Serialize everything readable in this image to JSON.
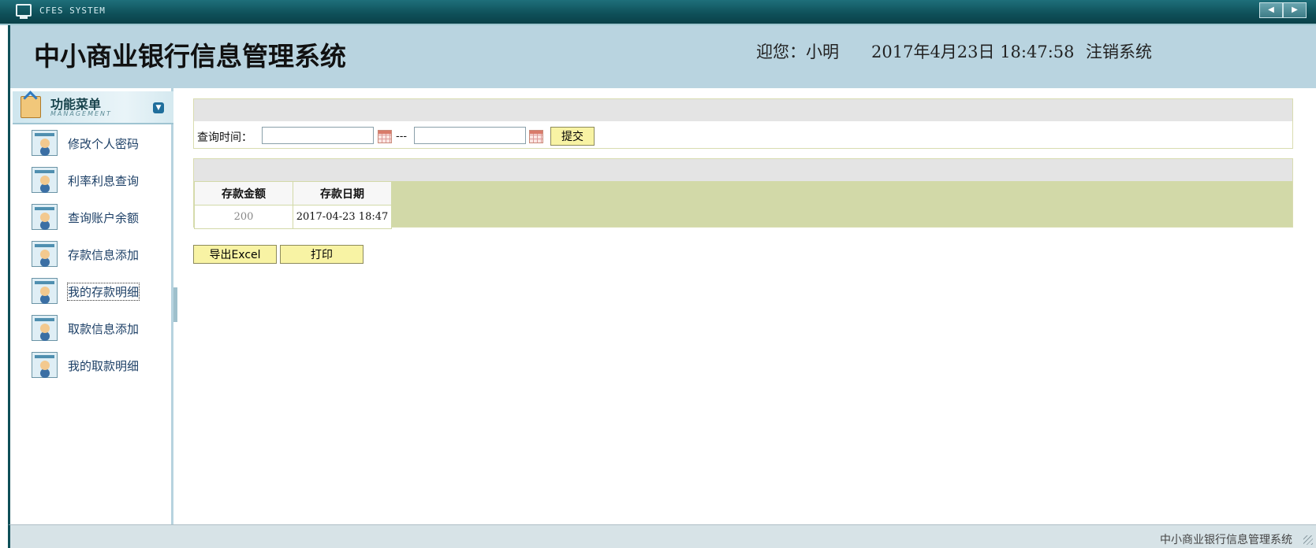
{
  "window": {
    "app_name": "CFES SYSTEM"
  },
  "header": {
    "title": "中小商业银行信息管理系统",
    "welcome": "迎您：小明",
    "datetime": "2017年4月23日  18:47:58",
    "logout": "注销系统"
  },
  "sidebar": {
    "title": "功能菜单",
    "subtitle": "MANAGEMENT",
    "items": [
      {
        "label": "修改个人密码"
      },
      {
        "label": "利率利息查询"
      },
      {
        "label": "查询账户余额"
      },
      {
        "label": "存款信息添加"
      },
      {
        "label": "我的存款明细"
      },
      {
        "label": "取款信息添加"
      },
      {
        "label": "我的取款明细"
      }
    ]
  },
  "search": {
    "label": "查询时间：",
    "start_value": "",
    "end_value": "",
    "separator": "---",
    "submit_label": "提交"
  },
  "table": {
    "headers": [
      "存款金额",
      "存款日期"
    ],
    "rows": [
      {
        "amount": "200",
        "date": "2017-04-23 18:47"
      }
    ]
  },
  "actions": {
    "export_label": "导出Excel",
    "print_label": "打印"
  },
  "footer": {
    "text": "中小商业银行信息管理系统"
  },
  "colors": {
    "titlebar": "#0e4f58",
    "header_bg": "#b9d4e0",
    "button_bg": "#f8f3a4",
    "table_band": "#d2d9a8"
  }
}
